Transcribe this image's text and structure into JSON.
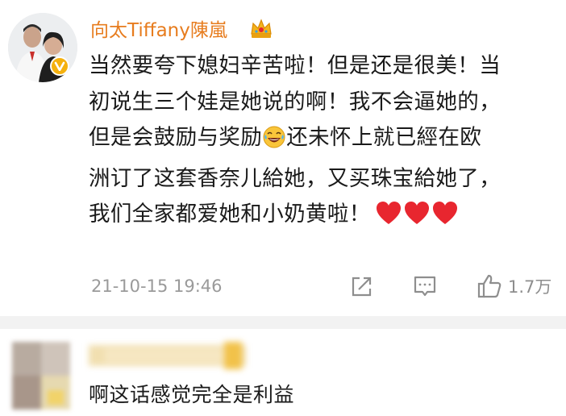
{
  "post": {
    "username": "向太Tiffany陳嵐",
    "badge_icon": "crown-emoji",
    "content_lines": [
      "当然要夸下媳妇辛苦啦！但是还是很美！当",
      "初说生三个娃是她说的啊！我不会逼她的，",
      "但是会鼓励与奖励",
      "还未怀上就已經在欧",
      "洲订了这套香奈儿給她，又买珠宝給她了，",
      "我们全家都爱她和小奶黄啦！"
    ],
    "timestamp": "21-10-15 19:46",
    "like_count": "1.7万",
    "heart_color": "#e8262f",
    "username_color": "#e77c1e"
  },
  "comment": {
    "text": "啊这话感觉完全是利益"
  }
}
